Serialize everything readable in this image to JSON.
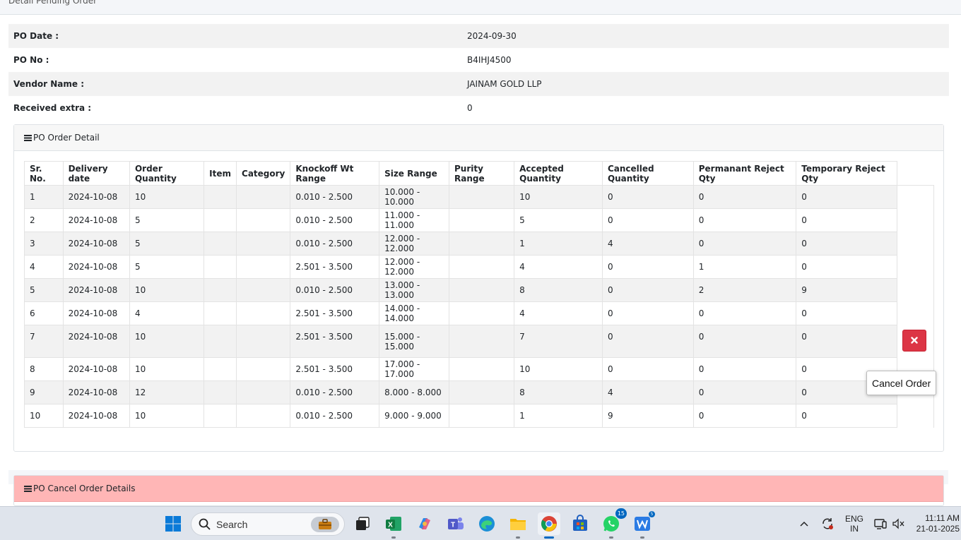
{
  "page": {
    "title": "Detail Pending Order"
  },
  "po_info": [
    {
      "label": "PO Date :",
      "value": "2024-09-30"
    },
    {
      "label": "PO No :",
      "value": "B4IHJ4500"
    },
    {
      "label": "Vendor Name :",
      "value": "JAINAM GOLD LLP"
    },
    {
      "label": "Received extra :",
      "value": "0"
    }
  ],
  "order_detail": {
    "title": "PO Order Detail",
    "columns": [
      "Sr. No.",
      "Delivery date",
      "Order Quantity",
      "Item",
      "Category",
      "Knockoff Wt Range",
      "Size Range",
      "Purity Range",
      "Accepted Quantity",
      "Cancelled Quantity",
      "Permanant Reject Qty",
      "Temporary Reject Qty"
    ],
    "rows": [
      [
        "1",
        "2024-10-08",
        "10",
        "",
        "",
        "0.010 - 2.500",
        "10.000 - 10.000",
        "",
        "10",
        "0",
        "0",
        "0"
      ],
      [
        "2",
        "2024-10-08",
        "5",
        "",
        "",
        "0.010 - 2.500",
        "11.000 - 11.000",
        "",
        "5",
        "0",
        "0",
        "0"
      ],
      [
        "3",
        "2024-10-08",
        "5",
        "",
        "",
        "0.010 - 2.500",
        "12.000 - 12.000",
        "",
        "1",
        "4",
        "0",
        "0"
      ],
      [
        "4",
        "2024-10-08",
        "5",
        "",
        "",
        "2.501 - 3.500",
        "12.000 - 12.000",
        "",
        "4",
        "0",
        "1",
        "0"
      ],
      [
        "5",
        "2024-10-08",
        "10",
        "",
        "",
        "0.010 - 2.500",
        "13.000 - 13.000",
        "",
        "8",
        "0",
        "2",
        "9"
      ],
      [
        "6",
        "2024-10-08",
        "4",
        "",
        "",
        "2.501 - 3.500",
        "14.000 - 14.000",
        "",
        "4",
        "0",
        "0",
        "0"
      ],
      [
        "7",
        "2024-10-08",
        "10",
        "",
        "",
        "2.501 - 3.500",
        "15.000 - 15.000",
        "",
        "7",
        "0",
        "0",
        "0"
      ],
      [
        "8",
        "2024-10-08",
        "10",
        "",
        "",
        "2.501 - 3.500",
        "17.000 - 17.000",
        "",
        "10",
        "0",
        "0",
        "0"
      ],
      [
        "9",
        "2024-10-08",
        "12",
        "",
        "",
        "0.010 - 2.500",
        "8.000 - 8.000",
        "",
        "8",
        "4",
        "0",
        "0"
      ],
      [
        "10",
        "2024-10-08",
        "10",
        "",
        "",
        "0.010 - 2.500",
        "9.000 - 9.000",
        "",
        "1",
        "9",
        "0",
        "0"
      ]
    ],
    "cancel_tooltip": "Cancel Order"
  },
  "cancel_detail": {
    "title": "PO Cancel Order Details"
  },
  "taskbar": {
    "search_placeholder": "Search",
    "whatsapp_badge": "15",
    "word_badge": "5",
    "lang_top": "ENG",
    "lang_bottom": "IN",
    "time": "11:11 AM",
    "date": "21-01-2025"
  },
  "colors": {
    "danger": "#dc3545",
    "cancel_header": "#ffb6b6",
    "accent": "#0067c0"
  }
}
